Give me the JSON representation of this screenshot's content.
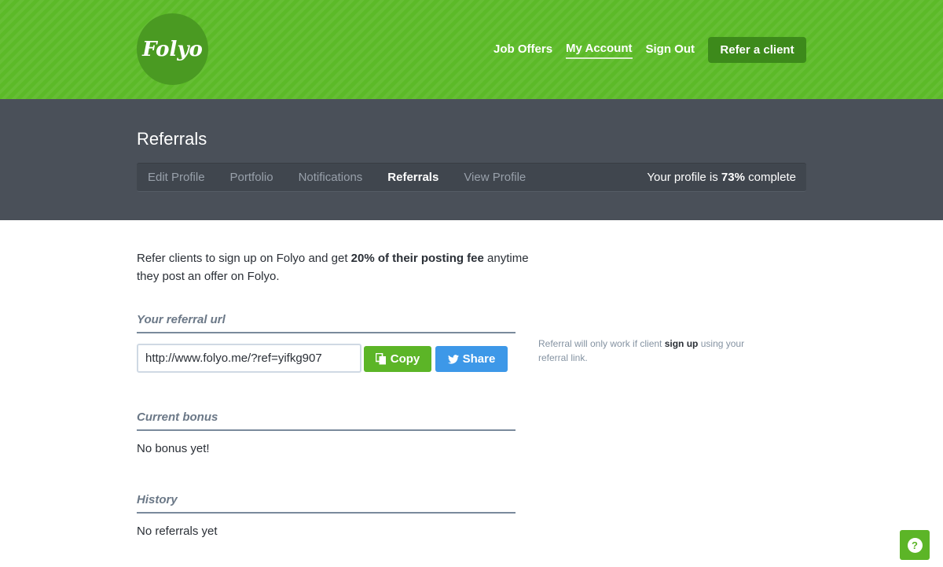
{
  "header": {
    "logo_text": "Folyo",
    "nav": [
      {
        "label": "Job Offers"
      },
      {
        "label": "My Account"
      },
      {
        "label": "Sign Out"
      }
    ],
    "cta_label": "Refer a client"
  },
  "subheader": {
    "title": "Referrals",
    "tabs": [
      {
        "label": "Edit Profile"
      },
      {
        "label": "Portfolio"
      },
      {
        "label": "Notifications"
      },
      {
        "label": "Referrals"
      },
      {
        "label": "View Profile"
      }
    ],
    "progress_prefix": "Your profile is ",
    "progress_value": "73%",
    "progress_suffix": " complete"
  },
  "intro": {
    "part1": "Refer clients to sign up on Folyo and get ",
    "bold": "20% of their posting fee",
    "part2": " anytime they post an offer on Folyo."
  },
  "referral": {
    "section_title": "Your referral url",
    "url_value": "http://www.folyo.me/?ref=yifkg907",
    "copy_label": "Copy",
    "share_label": "Share",
    "hint_part1": "Referral will only work if client ",
    "hint_bold": "sign up",
    "hint_part2": " using your referral link."
  },
  "bonus": {
    "section_title": "Current bonus",
    "text": "No bonus yet!"
  },
  "history": {
    "section_title": "History",
    "text": "No referrals yet"
  },
  "help": {
    "label": "?"
  },
  "colors": {
    "brand_green": "#5cba28",
    "subheader_bg": "#4a5059",
    "share_blue": "#3d98e8"
  },
  "icons": [
    "copy-icon",
    "twitter-icon",
    "help-icon"
  ]
}
